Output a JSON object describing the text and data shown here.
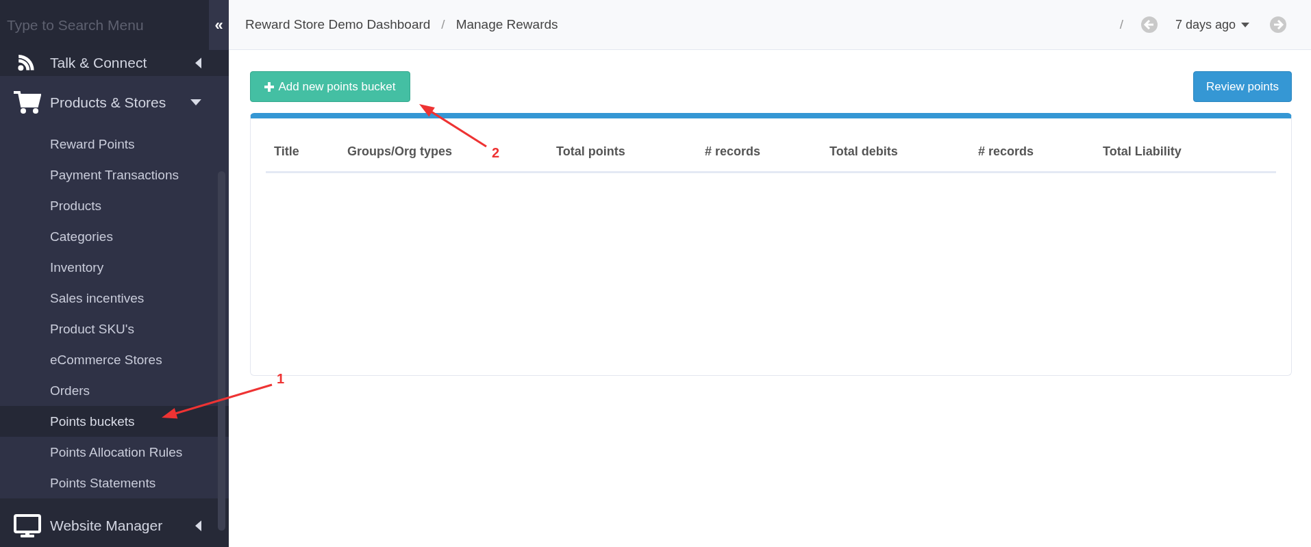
{
  "sidebar": {
    "search": {
      "placeholder": "Type to Search Menu"
    },
    "collapse": "«",
    "menu": [
      {
        "label": "Talk & Connect",
        "expanded": false
      },
      {
        "label": "Products & Stores",
        "expanded": true,
        "children": [
          {
            "label": "Reward Points",
            "selected": false
          },
          {
            "label": "Payment Transactions",
            "selected": false
          },
          {
            "label": "Products",
            "selected": false
          },
          {
            "label": "Categories",
            "selected": false
          },
          {
            "label": "Inventory",
            "selected": false
          },
          {
            "label": "Sales incentives",
            "selected": false
          },
          {
            "label": "Product SKU's",
            "selected": false
          },
          {
            "label": "eCommerce Stores",
            "selected": false
          },
          {
            "label": "Orders",
            "selected": false
          },
          {
            "label": "Points buckets",
            "selected": true
          },
          {
            "label": "Points Allocation Rules",
            "selected": false
          },
          {
            "label": "Points Statements",
            "selected": false
          }
        ]
      },
      {
        "label": "Website Manager",
        "expanded": false
      }
    ]
  },
  "header": {
    "breadcrumbs": [
      "Reward Store Demo Dashboard",
      "Manage Rewards"
    ],
    "separator": "/",
    "range_separator": "/",
    "date_range": "7 days ago"
  },
  "buttons": {
    "add": "Add new points bucket",
    "review": "Review points"
  },
  "table": {
    "columns": [
      "Title",
      "Groups/Org types",
      "Total points",
      "# records",
      "Total debits",
      "# records",
      "Total Liability"
    ]
  },
  "annotations": [
    {
      "label": "1"
    },
    {
      "label": "2"
    }
  ]
}
